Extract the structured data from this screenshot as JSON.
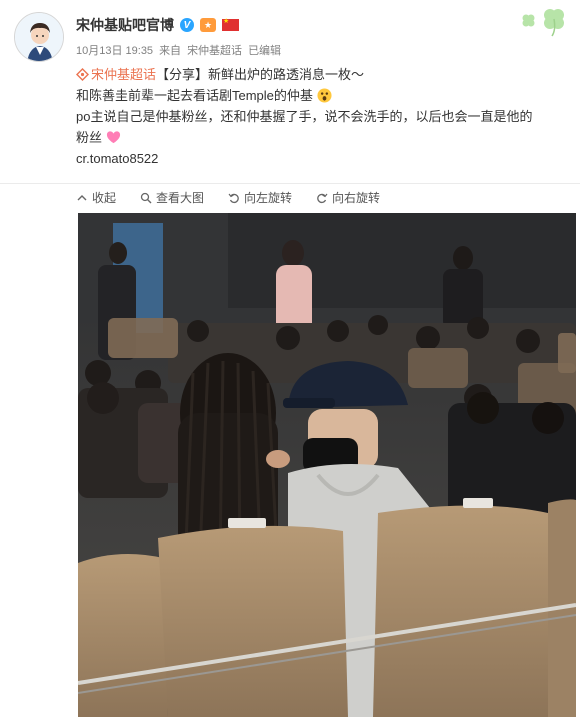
{
  "author": {
    "name": "宋仲基贴吧官博",
    "vip_mark": "V"
  },
  "meta": {
    "date": "10月13日 19:35",
    "source_prefix": "来自",
    "source": "宋仲基超话",
    "edited": "已编辑"
  },
  "post": {
    "topic": "宋仲基超话",
    "line1_rest": "【分享】新鲜出炉的路透消息一枚～",
    "line2": "和陈善圭前辈一起去看话剧Temple的仲基",
    "line3": "po主说自己是仲基粉丝，还和仲基握了手，说不会洗手的，以后也会一直是他的",
    "line4": "粉丝",
    "credit": "cr.tomato8522"
  },
  "actions": [
    {
      "label": "收起",
      "icon": "collapse-arrow-icon"
    },
    {
      "label": "查看大图",
      "icon": "magnifier-icon"
    },
    {
      "label": "向左旋转",
      "icon": "rotate-left-icon"
    },
    {
      "label": "向右旋转",
      "icon": "rotate-right-icon"
    }
  ],
  "colors": {
    "topic": "#eb7350",
    "vip": "#2aa5ff",
    "meta": "#808080"
  }
}
